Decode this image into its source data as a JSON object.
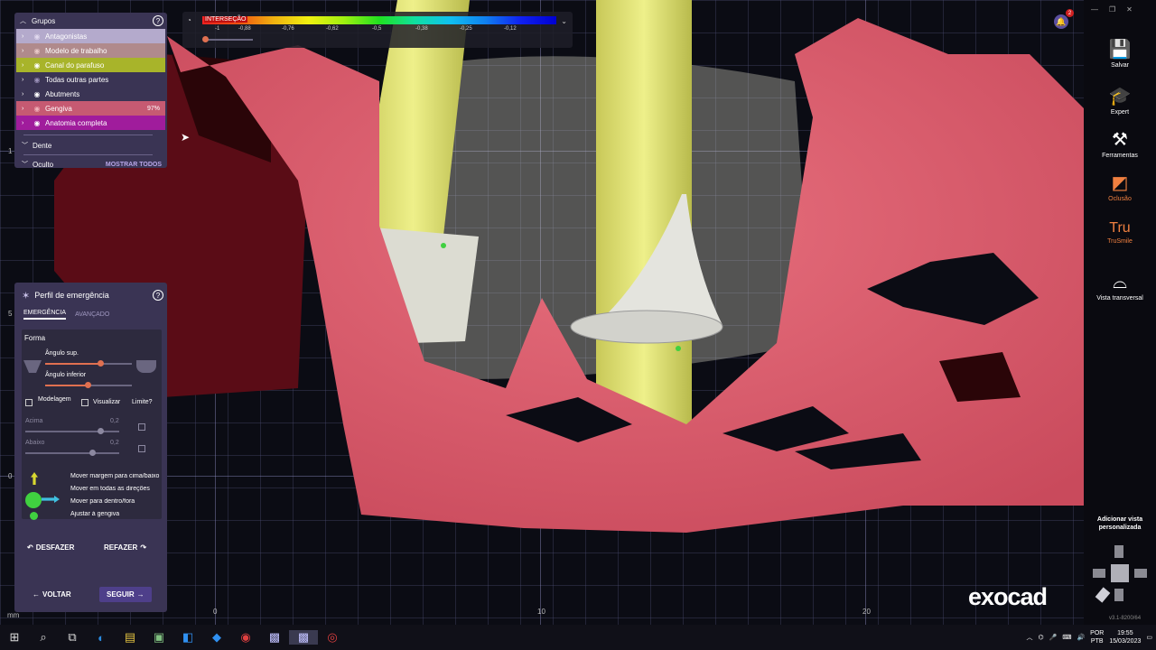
{
  "groups_panel": {
    "title": "Grupos",
    "items": [
      {
        "label": "Antagonistas",
        "color": "#b4aacc"
      },
      {
        "label": "Modelo de trabalho",
        "color": "#b08a8c"
      },
      {
        "label": "Canal do parafuso",
        "color": "#a8b42a"
      },
      {
        "label": "Todas outras partes",
        "color": "#8c7aa6"
      },
      {
        "label": "Abutments",
        "color": "#3a3454"
      },
      {
        "label": "Gengiva",
        "color": "#c65a72",
        "opacity": "97%"
      },
      {
        "label": "Anatomia completa",
        "color": "#a01c9c"
      }
    ],
    "tooth_label": "Dente",
    "hidden_label": "Oculto",
    "show_all": "MOSTRAR TODOS"
  },
  "intersection": {
    "label": "INTERSEÇÃO",
    "ticks": [
      "-1",
      "-0,88",
      "-0,76",
      "-0,62",
      "-0,5",
      "-0,38",
      "-0,25",
      "-0,12"
    ]
  },
  "emergence_panel": {
    "title": "Perfil de emergência",
    "tabs": [
      "EMERGÊNCIA",
      "AVANÇADO"
    ],
    "section": "Forma",
    "angle_sup": "Ângulo sup.",
    "angle_inf": "Ângulo inferior",
    "modeling": "Modelagem",
    "visualize": "Visualizar",
    "limit": "Limite?",
    "above": "Acima",
    "below": "Abaixo",
    "above_value": "0,2",
    "below_value": "0,2",
    "options": [
      "Mover margem para cima/baixo",
      "Mover em todas as direções",
      "Mover para dentro/fora",
      "Ajustar à gengiva"
    ],
    "undo": "DESFAZER",
    "redo": "REFAZER",
    "back": "VOLTAR",
    "next": "SEGUIR"
  },
  "right_toolbar": {
    "items": [
      {
        "label": "Salvar",
        "icon": "save-icon"
      },
      {
        "label": "Expert",
        "icon": "graduation-cap-icon"
      },
      {
        "label": "Ferramentas",
        "icon": "tools-icon"
      },
      {
        "label": "Oclusão",
        "icon": "occlusion-icon"
      },
      {
        "label": "TruSmile",
        "icon": "trusmile-icon"
      },
      {
        "label": "Vista transversal",
        "icon": "cross-section-icon"
      }
    ],
    "custom_view": "Adicionar vista personalizada",
    "version": "v3.1-8200/64"
  },
  "notification_count": "2",
  "brand": "exocad",
  "axis": {
    "unit": "mm",
    "x_ticks": [
      "0",
      "10",
      "20"
    ],
    "y_ticks": [
      "1",
      "5",
      "0"
    ]
  },
  "taskbar": {
    "language": "POR",
    "layout": "PTB",
    "time": "19:55",
    "date": "15/03/2023"
  }
}
